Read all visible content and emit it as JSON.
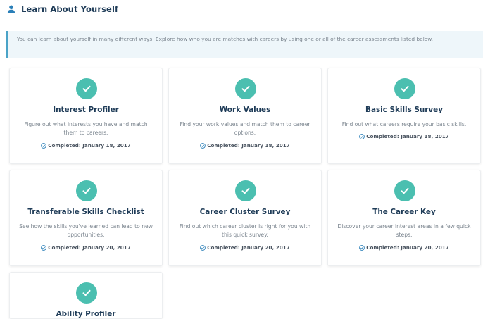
{
  "header": {
    "title": "Learn About Yourself",
    "icon": "user-icon"
  },
  "info": {
    "text": "You can learn about yourself in many different ways. Explore how who you are matches with careers by using one or all of the career assessments listed below."
  },
  "colors": {
    "accent": "#4bbfb0",
    "title": "#1e3b57",
    "info_border": "#4aa3c7",
    "info_bg": "#eef6fa"
  },
  "assessments": [
    {
      "title": "Interest Profiler",
      "description": "Figure out what interests you have and match them to careers.",
      "status": "Completed: January 18, 2017"
    },
    {
      "title": "Work Values",
      "description": "Find your work values and match them to career options.",
      "status": "Completed: January 18, 2017"
    },
    {
      "title": "Basic Skills Survey",
      "description": "Find out what careers require your basic skills.",
      "status": "Completed: January 18, 2017"
    },
    {
      "title": "Transferable Skills Checklist",
      "description": "See how the skills you've learned can lead to new opportunities.",
      "status": "Completed: January 20, 2017"
    },
    {
      "title": "Career Cluster Survey",
      "description": "Find out which career cluster is right for you with this quick survey.",
      "status": "Completed: January 20, 2017"
    },
    {
      "title": "The Career Key",
      "description": "Discover your career interest areas in a few quick steps.",
      "status": "Completed: January 20, 2017"
    },
    {
      "title": "Ability Profiler",
      "description": "",
      "status": ""
    }
  ]
}
